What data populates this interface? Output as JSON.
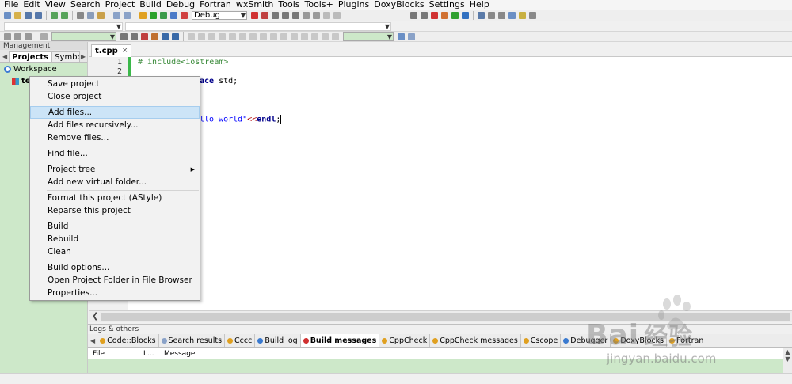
{
  "menubar": [
    "File",
    "Edit",
    "View",
    "Search",
    "Project",
    "Build",
    "Debug",
    "Fortran",
    "wxSmith",
    "Tools",
    "Tools+",
    "Plugins",
    "DoxyBlocks",
    "Settings",
    "Help"
  ],
  "toolbar": {
    "build_target": "Debug"
  },
  "management": {
    "title": "Management",
    "tabs": [
      "Projects",
      "Symbols"
    ],
    "tree": {
      "workspace": "Workspace",
      "project": "te"
    }
  },
  "editor": {
    "tab_label": "t.cpp",
    "close_glyph": "×",
    "line_numbers": [
      "1",
      "2"
    ],
    "code": {
      "l1": "# include<iostream>",
      "l2_kw": "ace",
      "l2_rest": " std;",
      "l5_pre": "llo world\"",
      "l5_op": "<<",
      "l5_kw": "endl",
      "l5_end": ";"
    }
  },
  "context_menu": {
    "items": [
      {
        "label": "Save project"
      },
      {
        "label": "Close project"
      },
      {
        "label": "Add files...",
        "hover": true
      },
      {
        "label": "Add files recursively..."
      },
      {
        "label": "Remove files..."
      },
      {
        "label": "Find file..."
      },
      {
        "label": "Project tree",
        "submenu": true
      },
      {
        "label": "Add new virtual folder..."
      },
      {
        "label": "Format this project (AStyle)"
      },
      {
        "label": "Reparse this project"
      },
      {
        "label": "Build"
      },
      {
        "label": "Rebuild"
      },
      {
        "label": "Clean"
      },
      {
        "label": "Build options..."
      },
      {
        "label": "Open Project Folder in File Browser"
      },
      {
        "label": "Properties..."
      }
    ]
  },
  "logs": {
    "title": "Logs & others",
    "tabs": [
      "Code::Blocks",
      "Search results",
      "Cccc",
      "Build log",
      "Build messages",
      "CppCheck",
      "CppCheck messages",
      "Cscope",
      "Debugger",
      "DoxyBlocks",
      "Fortran"
    ],
    "active_tab": "Build messages",
    "columns": [
      "File",
      "L...",
      "Message"
    ]
  },
  "watermark": {
    "brand": "Bai",
    "brand2": "经验",
    "url": "jingyan.baidu.com"
  },
  "colors": {
    "accent_green": "#cde8c9",
    "hover_blue": "#cce4f7",
    "keyword": "#00008b",
    "string": "#0000ff",
    "preprocessor": "#3a8a3a",
    "operator": "#b00000"
  }
}
